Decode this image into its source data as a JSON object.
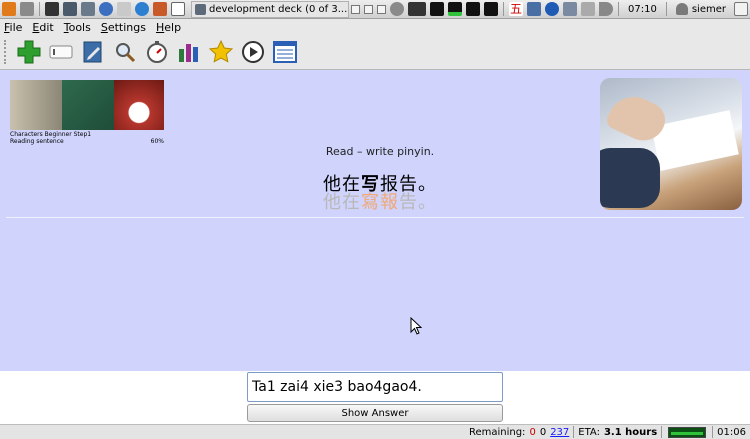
{
  "panel": {
    "window_title": "development deck (0 of 3...",
    "clock": "07:10",
    "user": "siemer"
  },
  "menu": [
    "File",
    "Edit",
    "Tools",
    "Settings",
    "Help"
  ],
  "toolbar": [
    {
      "name": "add-icon",
      "color": "#2e9e2e"
    },
    {
      "name": "card-icon",
      "color": "#888888"
    },
    {
      "name": "edit-icon",
      "color": "#3b6ea8"
    },
    {
      "name": "search-icon",
      "color": "#555555"
    },
    {
      "name": "timer-icon",
      "color": "#777777"
    },
    {
      "name": "stats-icon",
      "color": "#9b2d8f"
    },
    {
      "name": "star-icon",
      "color": "#f2c200"
    },
    {
      "name": "play-icon",
      "color": "#333333"
    },
    {
      "name": "list-icon",
      "color": "#2a5fb5"
    }
  ],
  "deck": {
    "name": "Characters Beginner Step1",
    "subtitle": "Reading sentence",
    "percent": "60%"
  },
  "card": {
    "question": "Read – write pinyin.",
    "chars_parts": [
      "他在",
      "写",
      "报告。"
    ],
    "traditional_parts": [
      "他在",
      "寫報",
      "告。"
    ]
  },
  "answer": {
    "value": "Ta1 zai4 xie3 bao4gao4.",
    "show_button": "Show Answer"
  },
  "status": {
    "remaining_label": "Remaining:",
    "remaining_new": "0",
    "remaining_rev": "0",
    "remaining_total": "237",
    "eta_label": "ETA:",
    "eta_value": "3.1 hours",
    "time": "01:06"
  },
  "colors": {
    "main_bg": "#d0d4fc",
    "highlight": "#f0a878",
    "faded": "#b8b8b8"
  }
}
